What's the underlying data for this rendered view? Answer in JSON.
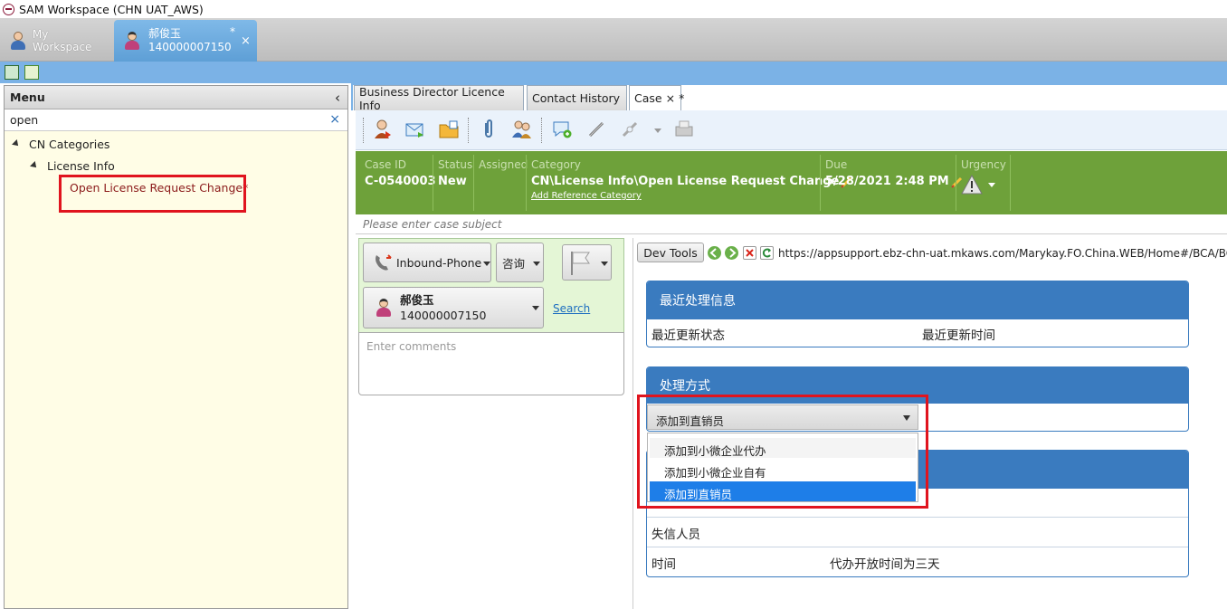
{
  "window": {
    "title": "SAM Workspace (CHN UAT_AWS)"
  },
  "workspace_tabs": {
    "my_workspace": "My Workspace",
    "customer_name": "郝俊玉",
    "customer_id": "140000007150",
    "modified_marker": "*",
    "close": "×"
  },
  "menu": {
    "title": "Menu",
    "collapse": "‹",
    "search_value": "open",
    "search_clear": "×",
    "tree": {
      "root": "CN Categories",
      "child": "License Info",
      "leaf": "Open License Request Change*"
    }
  },
  "case_tabs": [
    {
      "label": "Business Director Licence Info"
    },
    {
      "label": "Contact History"
    },
    {
      "label": "Case"
    }
  ],
  "case_tab_close": "×",
  "case_tab_modified": "*",
  "case_header": {
    "case_id_label": "Case ID",
    "case_id": "C-0540003",
    "status_label": "Status",
    "status": "New",
    "assigned_label": "Assigned",
    "assigned": "",
    "category_label": "Category",
    "category": "CN\\License Info\\Open License Request Change",
    "add_reference": "Add Reference Category",
    "due_label": "Due",
    "due": "5/28/2021 2:48 PM",
    "urgency_label": "Urgency"
  },
  "subject_placeholder": "Please enter case subject",
  "contact_form": {
    "channel": "Inbound-Phone",
    "type": "咨询",
    "contact_name": "郝俊玉",
    "contact_id": "140000007150",
    "search_link": "Search",
    "comments_placeholder": "Enter comments"
  },
  "browser": {
    "dev_tools": "Dev Tools",
    "url": "https://appsupport.ebz-chn-uat.mkaws.com/Marykay.FO.China.WEB/Home#/BCA/BCALicenseInfo"
  },
  "panels": {
    "recent": {
      "title": "最近处理信息",
      "status_label": "最近更新状态",
      "time_label": "最近更新时间"
    },
    "handling": {
      "title": "处理方式",
      "selected": "添加到直销员",
      "options": [
        "添加到小微企业代办",
        "添加到小微企业自有",
        "添加到直销员"
      ]
    },
    "third": {
      "row1_label": "失信人员",
      "row2_label": "时间",
      "row2_value": "代办开放时间为三天"
    }
  },
  "colors": {
    "accent_blue": "#3a7bbf",
    "case_green": "#6ea13a",
    "highlight_red": "#e0141e",
    "selection_blue": "#1e7ee8"
  }
}
